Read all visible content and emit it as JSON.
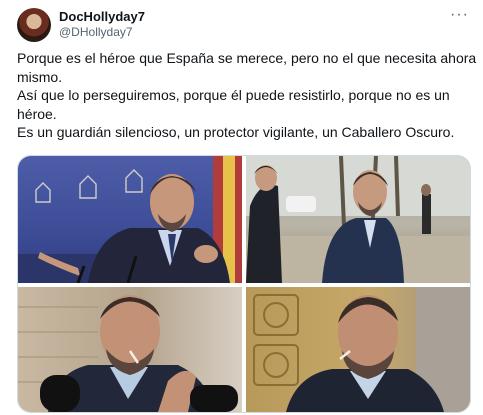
{
  "author": {
    "display_name": "DocHollyday7",
    "handle": "@DHollyday7"
  },
  "more_label": "···",
  "tweet": {
    "lines": [
      "Porque es el héroe que España se merece, pero no el que necesita ahora mismo.",
      "Así que lo perseguiremos, porque él puede resistirlo, porque no es un héroe.",
      "Es un guardián silencioso, un protector vigilante, un Caballero Oscuro."
    ]
  },
  "media": {
    "photos": [
      {
        "name": "photo-man-at-podium"
      },
      {
        "name": "photo-man-walking-street"
      },
      {
        "name": "photo-man-with-toothpick-microphones"
      },
      {
        "name": "photo-man-with-toothpick-ornate-door"
      }
    ]
  },
  "colors": {
    "text": "#0f1419",
    "secondary_text": "#536471",
    "border": "#cfd9de"
  }
}
